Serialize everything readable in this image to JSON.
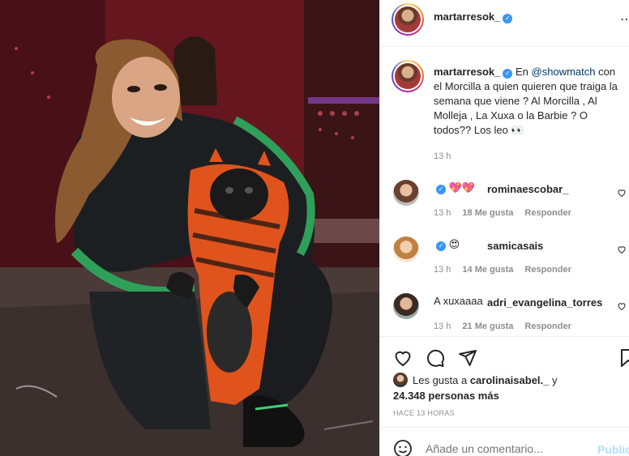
{
  "post": {
    "author": "martarresok_",
    "verified_glyph": "✓",
    "more_icon": "more-icon"
  },
  "caption": {
    "author": "martarresok_",
    "prefix": "En ",
    "mention": "@showmatch",
    "body": " con el Morcilla a quien quieren que traiga la semana que viene ? Al Morcilla , Al Molleja , La Xuxa o la Barbie ? O todos?? Los leo 👀",
    "time": "13 h"
  },
  "comments": [
    {
      "user": "rominaescobar_",
      "verified": true,
      "text": "💖💖",
      "time": "13 h",
      "likes": "18 Me gusta",
      "reply": "Responder"
    },
    {
      "user": "samicasais",
      "verified": true,
      "text": "😍",
      "time": "13 h",
      "likes": "14 Me gusta",
      "reply": "Responder"
    },
    {
      "user": "adri_evangelina_torres",
      "verified": false,
      "text": "A xuxaaaa",
      "time": "13 h",
      "likes": "21 Me gusta",
      "reply": "Responder"
    }
  ],
  "likes": {
    "prefix": "Les gusta a ",
    "who": "carolinaisabel._",
    "mid": " y",
    "count": "24.348 personas más"
  },
  "timestamp": "HACE 13 HORAS",
  "add_comment": {
    "placeholder": "Añade un comentario...",
    "post_label": "Publicar"
  },
  "colors": {
    "link": "#00376b",
    "verified": "#3897f0",
    "muted": "#8e8e8e",
    "post_disabled": "#b2dffc"
  }
}
